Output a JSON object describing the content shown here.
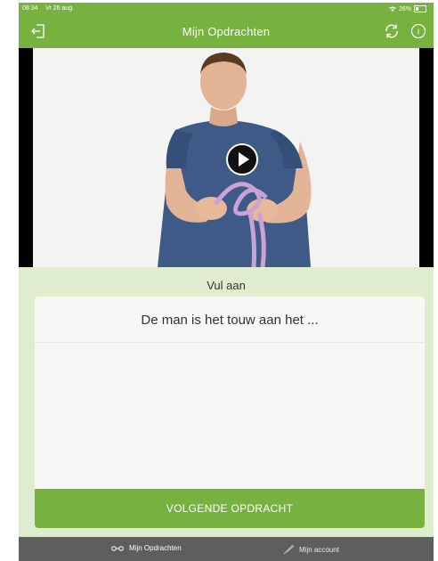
{
  "status": {
    "time": "08:34",
    "date": "Vr 26 aug.",
    "battery": "26%"
  },
  "header": {
    "title": "Mijn Opdrachten",
    "logout_icon": "logout-icon",
    "refresh_icon": "refresh-icon",
    "info_icon": "info-icon"
  },
  "video": {
    "play_icon": "play-icon"
  },
  "exercise": {
    "prompt": "Vul aan",
    "question": "De man is het touw aan het ...",
    "next_label": "VOLGENDE OPDRACHT"
  },
  "tabbar": {
    "items": [
      {
        "label": "Mijn Opdrachten",
        "icon": "glasses-icon"
      },
      {
        "label": "Mijn account",
        "icon": "feather-icon"
      }
    ]
  },
  "colors": {
    "accent": "#77b13f",
    "background": "#dfeccd",
    "tabbar": "#5e5e5e"
  }
}
